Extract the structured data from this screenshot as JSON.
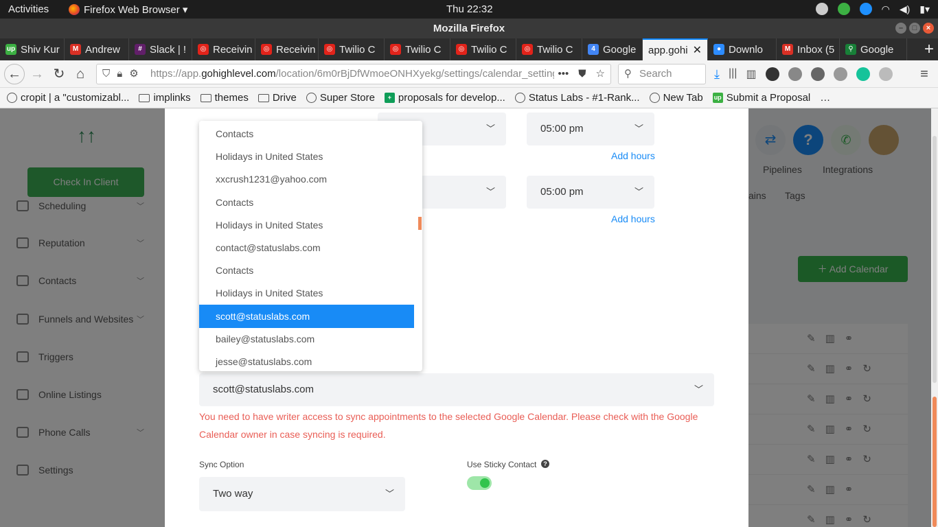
{
  "system": {
    "activities": "Activities",
    "app_menu": "Firefox Web Browser ▾",
    "clock": "Thu 22:32"
  },
  "window": {
    "title": "Mozilla Firefox"
  },
  "tabs": [
    {
      "label": "Shiv Kur",
      "fav_color": "#3cb043",
      "fav_glyph": "up"
    },
    {
      "label": "Andrew",
      "fav_color": "#d93025",
      "fav_glyph": "M"
    },
    {
      "label": "Slack | !",
      "fav_color": "#611f69",
      "fav_glyph": "#"
    },
    {
      "label": "Receivin",
      "fav_color": "#e2231a",
      "fav_glyph": "◎"
    },
    {
      "label": "Receivin",
      "fav_color": "#e2231a",
      "fav_glyph": "◎"
    },
    {
      "label": "Twilio C",
      "fav_color": "#e2231a",
      "fav_glyph": "◎"
    },
    {
      "label": "Twilio C",
      "fav_color": "#e2231a",
      "fav_glyph": "◎"
    },
    {
      "label": "Twilio C",
      "fav_color": "#e2231a",
      "fav_glyph": "◎"
    },
    {
      "label": "Twilio C",
      "fav_color": "#e2231a",
      "fav_glyph": "◎"
    },
    {
      "label": "Google",
      "fav_color": "#4285f4",
      "fav_glyph": "4"
    },
    {
      "label": "app.gohi",
      "fav_color": "#f4f4f4",
      "fav_glyph": ""
    },
    {
      "label": "Downlo",
      "fav_color": "#2d8cff",
      "fav_glyph": "●"
    },
    {
      "label": "Inbox (5",
      "fav_color": "#d93025",
      "fav_glyph": "M"
    },
    {
      "label": "Google",
      "fav_color": "#188038",
      "fav_glyph": "⚲"
    }
  ],
  "nav": {
    "url_prefix": "https://app.",
    "url_domain": "gohighlevel.com",
    "url_path": "/location/6m0rBjDfWmoeONHXyekg/settings/calendar_settings",
    "search_placeholder": "Search"
  },
  "bookmarks": [
    {
      "label": "cropit | a \"customizabl...",
      "icon": "globe-icon"
    },
    {
      "label": "implinks",
      "icon": "folder-icon"
    },
    {
      "label": "themes",
      "icon": "folder-icon"
    },
    {
      "label": "Drive",
      "icon": "folder-icon"
    },
    {
      "label": "Super Store",
      "icon": "globe-icon"
    },
    {
      "label": "proposals for develop...",
      "icon": "sheets-icon"
    },
    {
      "label": "Status Labs - #1-Rank...",
      "icon": "globe-icon"
    },
    {
      "label": "New Tab",
      "icon": "globe-icon"
    },
    {
      "label": "Submit a Proposal",
      "icon": "upwork-icon"
    },
    {
      "label": "…",
      "icon": ""
    }
  ],
  "sidebar": {
    "check_in": "Check In Client",
    "items": [
      {
        "label": "Scheduling"
      },
      {
        "label": "Reputation"
      },
      {
        "label": "Contacts"
      },
      {
        "label": "Funnels and Websites"
      },
      {
        "label": "Triggers"
      },
      {
        "label": "Online Listings"
      },
      {
        "label": "Phone Calls"
      },
      {
        "label": "Settings"
      }
    ]
  },
  "header": {
    "pipelines": "Pipelines",
    "integrations": "Integrations",
    "domains_partial": "ains",
    "tags": "Tags",
    "add_calendar": "Add Calendar"
  },
  "modal": {
    "hours": [
      {
        "start_partial": "m",
        "end": "05:00 pm",
        "add_hours": "Add hours"
      },
      {
        "start_partial": "m",
        "end": "05:00 pm",
        "add_hours": "Add hours"
      }
    ],
    "google_calendar_selected": "scott@statuslabs.com",
    "error": "You need to have writer access to sync appointments to the selected Google Calendar. Please check with the Google Calendar owner in case syncing is required.",
    "sync_option_label": "Sync Option",
    "sync_option_value": "Two way",
    "sticky_label": "Use Sticky Contact",
    "sticky_on": true
  },
  "dropdown": {
    "items": [
      "Contacts",
      "Holidays in United States",
      "xxcrush1231@yahoo.com",
      "Contacts",
      "Holidays in United States",
      "contact@statuslabs.com",
      "Contacts",
      "Holidays in United States",
      "scott@statuslabs.com",
      "bailey@statuslabs.com",
      "jesse@statuslabs.com"
    ],
    "selected_index": 8
  }
}
